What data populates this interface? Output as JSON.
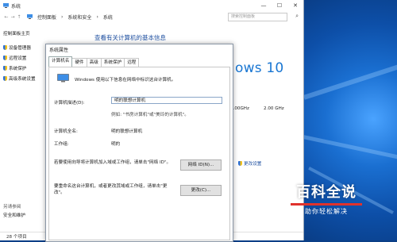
{
  "window": {
    "title": "系统"
  },
  "address": {
    "crumbs": [
      "控制面板",
      "系统和安全",
      "系统"
    ],
    "search_placeholder": "搜索控制面板"
  },
  "leftpane": {
    "home": "控制面板主页",
    "items": [
      "设备管理器",
      "远程设置",
      "系统保护",
      "高级系统设置"
    ],
    "see_also": "另请参阅",
    "security": "安全和维护"
  },
  "main": {
    "heading": "查看有关计算机的基本信息",
    "windows_brand": "ows 10",
    "cpu_speed1": "2.00GHz",
    "cpu_speed2": "2.00 GHz",
    "change_settings": "更改设置"
  },
  "statusbar": {
    "count": "28 个项目"
  },
  "dialog": {
    "title": "系统属性",
    "tabs": [
      "计算机名",
      "硬件",
      "高级",
      "系统保护",
      "远程"
    ],
    "intro": "Windows 使用以下信息在网络中标识这台计算机。",
    "desc_label": "计算机描述(D):",
    "desc_value": "明的联想计算机",
    "example": "例如: \"书房计算机\"或\"美玲的计算机\"。",
    "fullname_label": "计算机全名:",
    "fullname_value": "明的联想计算机",
    "workgroup_label": "工作组:",
    "workgroup_value": "明的",
    "network_text": "若要使用向导将计算机加入域或工作组，请单击\"网络 ID\"。",
    "network_button": "网络 ID(N)...",
    "rename_text": "要重命名这台计算机，或者更改其域或工作组，请单击\"更改\"。",
    "change_button": "更改(C)..."
  },
  "watermark": {
    "big": "百科全说",
    "small": "助你轻松解决"
  }
}
